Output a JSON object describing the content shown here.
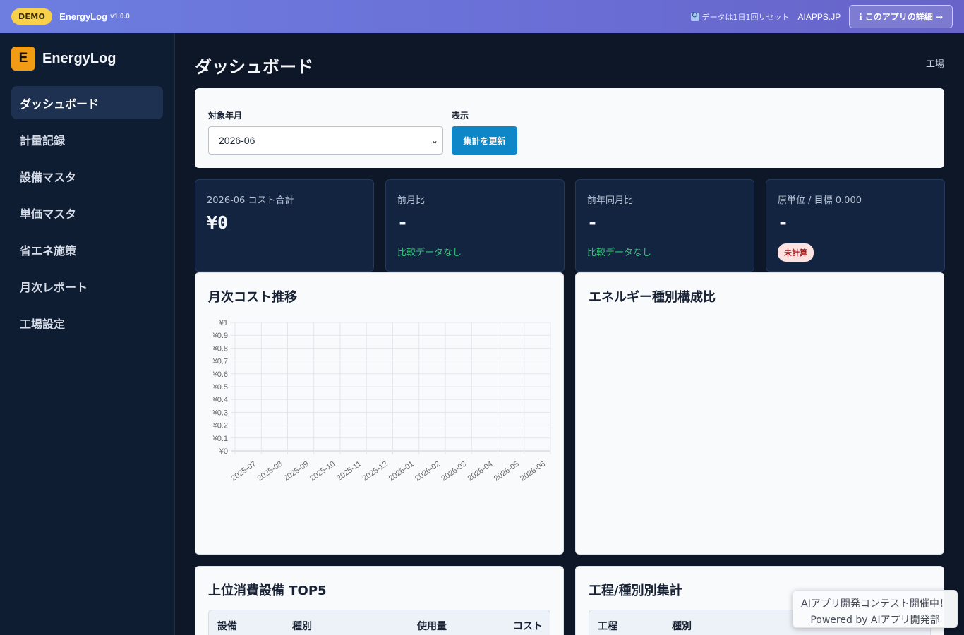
{
  "topbar": {
    "demo_badge": "DEMO",
    "app_name": "EnergyLog",
    "version": "v1.0.0",
    "reset_note": "データは1日1回リセット",
    "site_link": "AIAPPS.JP",
    "detail_button": "このアプリの詳細 →"
  },
  "sidebar": {
    "logo_letter": "E",
    "logo_text": "EnergyLog",
    "items": [
      {
        "label": "ダッシュボード"
      },
      {
        "label": "計量記録"
      },
      {
        "label": "設備マスタ"
      },
      {
        "label": "単価マスタ"
      },
      {
        "label": "省エネ施策"
      },
      {
        "label": "月次レポート"
      },
      {
        "label": "工場設定"
      }
    ]
  },
  "page": {
    "title": "ダッシュボード",
    "factory": "工場"
  },
  "filter": {
    "month_label": "対象年月",
    "month_value": "2026-06",
    "display_label": "表示",
    "refresh_button": "集計を更新"
  },
  "kpis": [
    {
      "label": "2026-06 コスト合計",
      "value": "¥0"
    },
    {
      "label": "前月比",
      "value": "-",
      "sub": "比較データなし"
    },
    {
      "label": "前年同月比",
      "value": "-",
      "sub": "比較データなし"
    },
    {
      "label": "原単位 / 目標 0.000",
      "value": "-",
      "badge": "未計算"
    }
  ],
  "panels": {
    "monthly_cost_title": "月次コスト推移",
    "energy_mix_title": "エネルギー種別構成比",
    "top5_title": "上位消費設備 TOP5",
    "process_title": "工程/種別別集計"
  },
  "top5_table": {
    "columns": [
      "設備",
      "種別",
      "使用量",
      "コスト"
    ]
  },
  "process_table": {
    "columns": [
      "工程",
      "種別"
    ]
  },
  "chart_data": {
    "type": "line",
    "title": "月次コスト推移",
    "categories": [
      "2025-07",
      "2025-08",
      "2025-09",
      "2025-10",
      "2025-11",
      "2025-12",
      "2026-01",
      "2026-02",
      "2026-03",
      "2026-04",
      "2026-05",
      "2026-06"
    ],
    "y_ticks": [
      "¥0",
      "¥0.1",
      "¥0.2",
      "¥0.3",
      "¥0.4",
      "¥0.5",
      "¥0.6",
      "¥0.7",
      "¥0.8",
      "¥0.9",
      "¥1"
    ],
    "ylim": [
      0,
      1
    ],
    "grid": true,
    "series": []
  },
  "toast": {
    "line1": "AIアプリ開発コンテスト開催中！",
    "line2": "Powered by AIアプリ開発部"
  },
  "colors": {
    "accent": "#0d87c8",
    "logo": "#f29b14",
    "positive": "#35c27a",
    "badge_bg": "#fde2e2"
  }
}
